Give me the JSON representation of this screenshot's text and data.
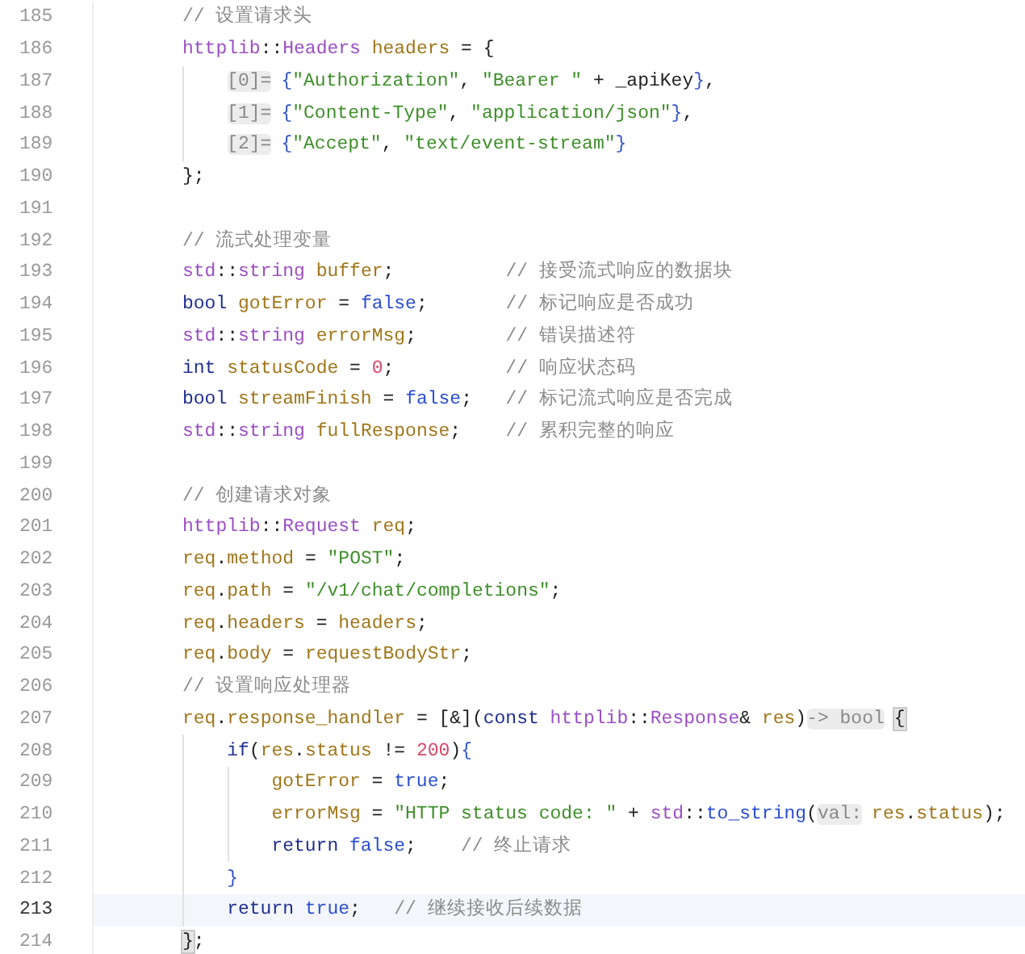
{
  "editor": {
    "lines": [
      {
        "number": "185",
        "current": false,
        "tokens": [
          {
            "kind": "comment",
            "text": "// 设置请求头"
          }
        ]
      },
      {
        "number": "186",
        "current": false,
        "tokens": [
          {
            "kind": "type",
            "text": "httplib"
          },
          {
            "kind": "plain",
            "text": "::"
          },
          {
            "kind": "type",
            "text": "Headers "
          },
          {
            "kind": "var",
            "text": "headers"
          },
          {
            "kind": "plain",
            "text": " = {"
          }
        ],
        "children": [
          {
            "number": "187",
            "current": false,
            "tokens": [
              {
                "kind": "hint",
                "text": "[0]="
              },
              {
                "kind": "brace",
                "text": "{"
              },
              {
                "kind": "str",
                "text": "\"Authorization\""
              },
              {
                "kind": "plain",
                "text": ", "
              },
              {
                "kind": "str",
                "text": "\"Bearer \""
              },
              {
                "kind": "plain",
                "text": " + _apiKey"
              },
              {
                "kind": "brace",
                "text": "}"
              },
              {
                "kind": "plain",
                "text": ","
              }
            ]
          },
          {
            "number": "188",
            "current": false,
            "tokens": [
              {
                "kind": "hint",
                "text": "[1]="
              },
              {
                "kind": "brace",
                "text": "{"
              },
              {
                "kind": "str",
                "text": "\"Content-Type\""
              },
              {
                "kind": "plain",
                "text": ", "
              },
              {
                "kind": "str",
                "text": "\"application/json\""
              },
              {
                "kind": "brace",
                "text": "}"
              },
              {
                "kind": "plain",
                "text": ","
              }
            ]
          },
          {
            "number": "189",
            "current": false,
            "tokens": [
              {
                "kind": "hint",
                "text": "[2]="
              },
              {
                "kind": "brace",
                "text": "{"
              },
              {
                "kind": "str",
                "text": "\"Accept\""
              },
              {
                "kind": "plain",
                "text": ", "
              },
              {
                "kind": "str",
                "text": "\"text/event-stream\""
              },
              {
                "kind": "brace",
                "text": "}"
              }
            ]
          }
        ]
      },
      {
        "number": "190",
        "current": false,
        "tokens": [
          {
            "kind": "plain",
            "text": "};"
          }
        ]
      },
      {
        "number": "191",
        "current": false
      },
      {
        "number": "192",
        "current": false,
        "tokens": [
          {
            "kind": "comment",
            "text": "// 流式处理变量"
          }
        ]
      },
      {
        "number": "193",
        "current": false,
        "tokens": [
          {
            "kind": "type",
            "text": "std"
          },
          {
            "kind": "plain",
            "text": "::"
          },
          {
            "kind": "type",
            "text": "string "
          },
          {
            "kind": "var",
            "text": "buffer"
          },
          {
            "kind": "plain",
            "text": ";          "
          },
          {
            "kind": "comment",
            "text": "// 接受流式响应的数据块"
          }
        ]
      },
      {
        "number": "194",
        "current": false,
        "tokens": [
          {
            "kind": "kw",
            "text": "bool "
          },
          {
            "kind": "var",
            "text": "gotError"
          },
          {
            "kind": "plain",
            "text": " = "
          },
          {
            "kind": "lit",
            "text": "false"
          },
          {
            "kind": "plain",
            "text": ";       "
          },
          {
            "kind": "comment",
            "text": "// 标记响应是否成功"
          }
        ]
      },
      {
        "number": "195",
        "current": false,
        "tokens": [
          {
            "kind": "type",
            "text": "std"
          },
          {
            "kind": "plain",
            "text": "::"
          },
          {
            "kind": "type",
            "text": "string "
          },
          {
            "kind": "var",
            "text": "errorMsg"
          },
          {
            "kind": "plain",
            "text": ";        "
          },
          {
            "kind": "comment",
            "text": "// 错误描述符"
          }
        ]
      },
      {
        "number": "196",
        "current": false,
        "tokens": [
          {
            "kind": "kw",
            "text": "int "
          },
          {
            "kind": "var",
            "text": "statusCode"
          },
          {
            "kind": "plain",
            "text": " = "
          },
          {
            "kind": "num",
            "text": "0"
          },
          {
            "kind": "plain",
            "text": ";          "
          },
          {
            "kind": "comment",
            "text": "// 响应状态码"
          }
        ]
      },
      {
        "number": "197",
        "current": false,
        "tokens": [
          {
            "kind": "kw",
            "text": "bool "
          },
          {
            "kind": "var",
            "text": "streamFinish"
          },
          {
            "kind": "plain",
            "text": " = "
          },
          {
            "kind": "lit",
            "text": "false"
          },
          {
            "kind": "plain",
            "text": ";   "
          },
          {
            "kind": "comment",
            "text": "// 标记流式响应是否完成"
          }
        ]
      },
      {
        "number": "198",
        "current": false,
        "tokens": [
          {
            "kind": "type",
            "text": "std"
          },
          {
            "kind": "plain",
            "text": "::"
          },
          {
            "kind": "type",
            "text": "string "
          },
          {
            "kind": "var",
            "text": "fullResponse"
          },
          {
            "kind": "plain",
            "text": ";    "
          },
          {
            "kind": "comment",
            "text": "// 累积完整的响应"
          }
        ]
      },
      {
        "number": "199",
        "current": false
      },
      {
        "number": "200",
        "current": false,
        "tokens": [
          {
            "kind": "comment",
            "text": "// 创建请求对象"
          }
        ]
      },
      {
        "number": "201",
        "current": false,
        "tokens": [
          {
            "kind": "type",
            "text": "httplib"
          },
          {
            "kind": "plain",
            "text": "::"
          },
          {
            "kind": "type",
            "text": "Request "
          },
          {
            "kind": "var",
            "text": "req"
          },
          {
            "kind": "plain",
            "text": ";"
          }
        ]
      },
      {
        "number": "202",
        "current": false,
        "tokens": [
          {
            "kind": "var",
            "text": "req"
          },
          {
            "kind": "plain",
            "text": "."
          },
          {
            "kind": "var",
            "text": "method"
          },
          {
            "kind": "plain",
            "text": " = "
          },
          {
            "kind": "str",
            "text": "\"POST\""
          },
          {
            "kind": "plain",
            "text": ";"
          }
        ]
      },
      {
        "number": "203",
        "current": false,
        "tokens": [
          {
            "kind": "var",
            "text": "req"
          },
          {
            "kind": "plain",
            "text": "."
          },
          {
            "kind": "var",
            "text": "path"
          },
          {
            "kind": "plain",
            "text": " = "
          },
          {
            "kind": "str",
            "text": "\"/v1/chat/completions\""
          },
          {
            "kind": "plain",
            "text": ";"
          }
        ]
      },
      {
        "number": "204",
        "current": false,
        "tokens": [
          {
            "kind": "var",
            "text": "req"
          },
          {
            "kind": "plain",
            "text": "."
          },
          {
            "kind": "var",
            "text": "headers"
          },
          {
            "kind": "plain",
            "text": " = "
          },
          {
            "kind": "var",
            "text": "headers"
          },
          {
            "kind": "plain",
            "text": ";"
          }
        ]
      },
      {
        "number": "205",
        "current": false,
        "tokens": [
          {
            "kind": "var",
            "text": "req"
          },
          {
            "kind": "plain",
            "text": "."
          },
          {
            "kind": "var",
            "text": "body"
          },
          {
            "kind": "plain",
            "text": " = "
          },
          {
            "kind": "var",
            "text": "requestBodyStr"
          },
          {
            "kind": "plain",
            "text": ";"
          }
        ]
      },
      {
        "number": "206",
        "current": false,
        "tokens": [
          {
            "kind": "comment",
            "text": "// 设置响应处理器"
          }
        ]
      },
      {
        "number": "207",
        "current": false,
        "tokens": [
          {
            "kind": "var",
            "text": "req"
          },
          {
            "kind": "plain",
            "text": "."
          },
          {
            "kind": "var",
            "text": "response_handler"
          },
          {
            "kind": "plain",
            "text": " = [&]("
          },
          {
            "kind": "kw",
            "text": "const "
          },
          {
            "kind": "type",
            "text": "httplib"
          },
          {
            "kind": "plain",
            "text": "::"
          },
          {
            "kind": "type",
            "text": "Response"
          },
          {
            "kind": "plain",
            "text": "& "
          },
          {
            "kind": "var",
            "text": "res"
          },
          {
            "kind": "plain",
            "text": ")"
          },
          {
            "kind": "hint",
            "text": "-> bool"
          },
          {
            "kind": "match",
            "text": "{"
          }
        ],
        "children": [
          {
            "number": "208",
            "current": false,
            "tokens": [
              {
                "kind": "kw",
                "text": "if"
              },
              {
                "kind": "plain",
                "text": "("
              },
              {
                "kind": "var",
                "text": "res"
              },
              {
                "kind": "plain",
                "text": "."
              },
              {
                "kind": "var",
                "text": "status"
              },
              {
                "kind": "plain",
                "text": " != "
              },
              {
                "kind": "num",
                "text": "200"
              },
              {
                "kind": "plain",
                "text": ")"
              },
              {
                "kind": "brace",
                "text": "{"
              }
            ],
            "children": [
              {
                "number": "209",
                "current": false,
                "tokens": [
                  {
                    "kind": "var",
                    "text": "gotError"
                  },
                  {
                    "kind": "plain",
                    "text": " = "
                  },
                  {
                    "kind": "lit",
                    "text": "true"
                  },
                  {
                    "kind": "plain",
                    "text": ";"
                  }
                ]
              },
              {
                "number": "210",
                "current": false,
                "tokens": [
                  {
                    "kind": "var",
                    "text": "errorMsg"
                  },
                  {
                    "kind": "plain",
                    "text": " = "
                  },
                  {
                    "kind": "str",
                    "text": "\"HTTP status code: \""
                  },
                  {
                    "kind": "plain",
                    "text": " + "
                  },
                  {
                    "kind": "type",
                    "text": "std"
                  },
                  {
                    "kind": "plain",
                    "text": "::"
                  },
                  {
                    "kind": "fn",
                    "text": "to_string"
                  },
                  {
                    "kind": "plain",
                    "text": "("
                  },
                  {
                    "kind": "hint",
                    "text": "val:"
                  },
                  {
                    "kind": "var",
                    "text": "res"
                  },
                  {
                    "kind": "plain",
                    "text": "."
                  },
                  {
                    "kind": "var",
                    "text": "status"
                  },
                  {
                    "kind": "plain",
                    "text": ");"
                  }
                ]
              },
              {
                "number": "211",
                "current": false,
                "tokens": [
                  {
                    "kind": "kw",
                    "text": "return "
                  },
                  {
                    "kind": "lit",
                    "text": "false"
                  },
                  {
                    "kind": "plain",
                    "text": ";    "
                  },
                  {
                    "kind": "comment",
                    "text": "// 终止请求"
                  }
                ]
              }
            ]
          },
          {
            "number": "212",
            "current": false,
            "tokens": [
              {
                "kind": "brace",
                "text": "}"
              }
            ]
          },
          {
            "number": "213",
            "current": true,
            "tokens": [
              {
                "kind": "kw",
                "text": "return "
              },
              {
                "kind": "lit",
                "text": "true"
              },
              {
                "kind": "plain",
                "text": ";   "
              },
              {
                "kind": "comment",
                "text": "// 继续接收后续数据"
              }
            ]
          }
        ]
      },
      {
        "number": "214",
        "current": false,
        "tokens": [
          {
            "kind": "match",
            "text": "}"
          },
          {
            "kind": "plain",
            "text": ";"
          }
        ]
      }
    ]
  }
}
